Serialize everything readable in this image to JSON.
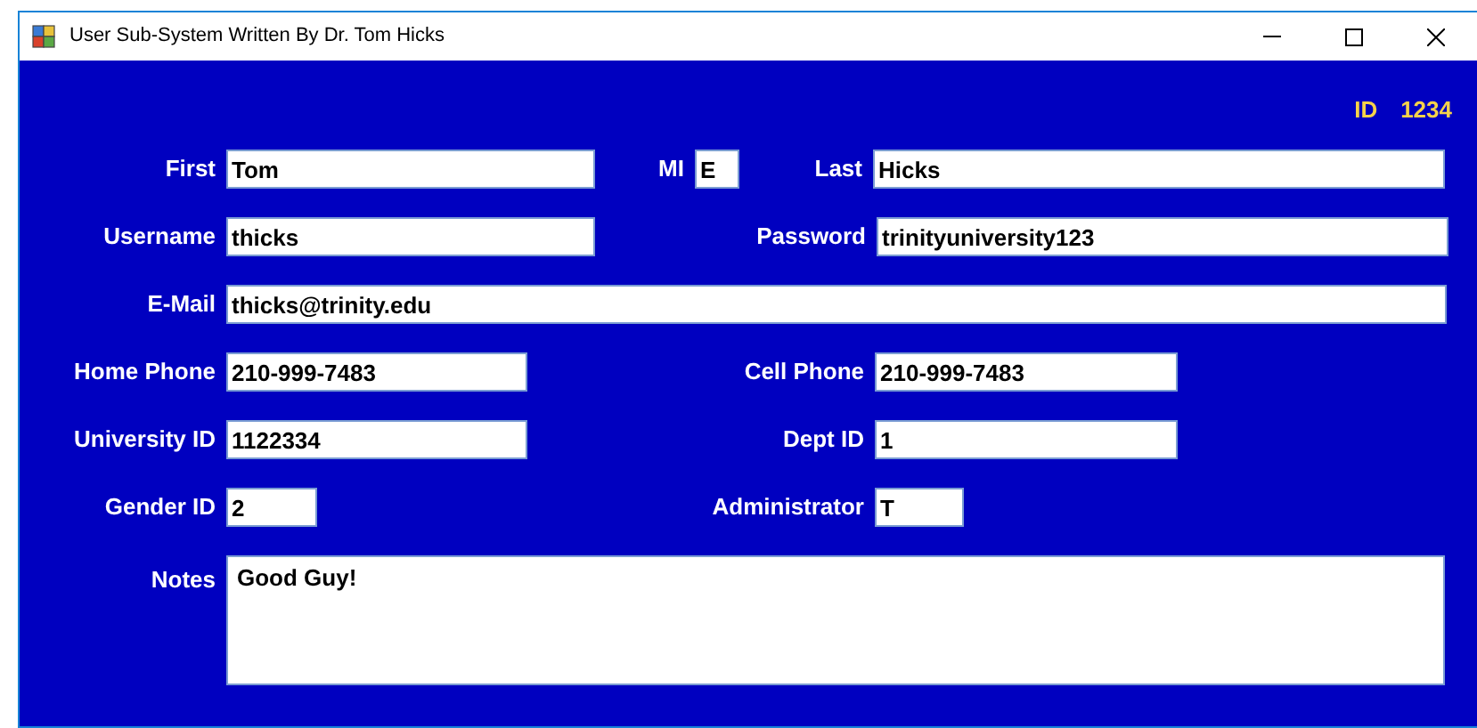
{
  "window": {
    "title": "User Sub-System Written By Dr. Tom Hicks"
  },
  "id": {
    "label": "ID",
    "value": "1234"
  },
  "rows": [
    [
      {
        "label": "First",
        "value": "Tom"
      },
      {
        "label": "MI",
        "value": "E"
      },
      {
        "label": "Last",
        "value": "Hicks"
      }
    ],
    [
      {
        "label": "Username",
        "value": "thicks"
      },
      {
        "label": "Password",
        "value": "trinityuniversity123"
      }
    ],
    [
      {
        "label": "E-Mail",
        "value": "thicks@trinity.edu"
      }
    ],
    [
      {
        "label": "Home Phone",
        "value": "210-999-7483"
      },
      {
        "label": "Cell Phone",
        "value": "210-999-7483"
      }
    ],
    [
      {
        "label": "University ID",
        "value": "1122334"
      },
      {
        "label": "Dept ID",
        "value": "1"
      }
    ],
    [
      {
        "label": "Gender ID",
        "value": "2"
      },
      {
        "label": "Administrator",
        "value": "T"
      }
    ]
  ],
  "notes": {
    "label": "Notes",
    "value": "Good Guy!"
  }
}
